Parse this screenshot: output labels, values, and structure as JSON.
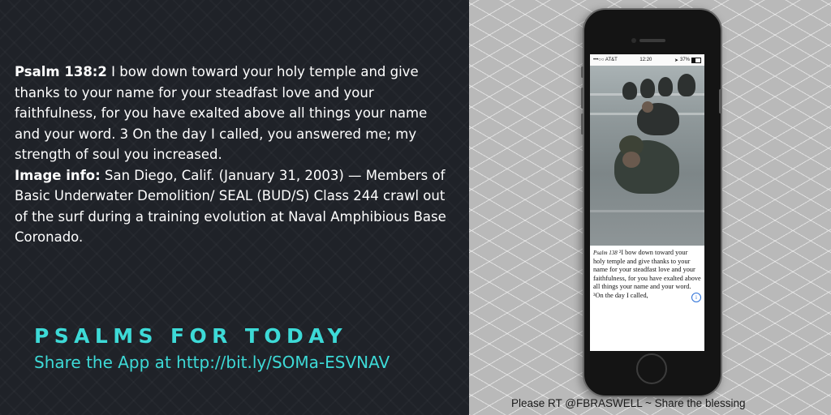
{
  "verse": {
    "reference": "Psalm 138:2",
    "text": "I bow down toward your holy temple and give thanks to your name for your steadfast love and your faithfulness, for you have exalted above all things your name and your word. 3 On the day I called, you answered me; my strength of soul you increased.",
    "image_info_label": "Image info:",
    "image_info_text": "San Diego, Calif. (January 31, 2003) — Members of Basic Underwater Demolition/ SEAL (BUD/S) Class 244 crawl out of the surf during a training evolution at Naval Amphibious Base Coronado."
  },
  "brand": {
    "title": "PSALMS FOR TODAY",
    "share_text": "Share the App at  http://bit.ly/SOMa-ESVNAV"
  },
  "footer": {
    "text": "Please RT @FBRASWELL ~ Share the blessing"
  },
  "phone": {
    "status": {
      "carrier": "•••○○ AT&T",
      "time": "12:20",
      "battery": "37%"
    },
    "caption": {
      "ref": "Psalm 138",
      "text": "²I bow down toward your holy temple and give thanks to your name for your steadfast love and your faithfulness, for you have exalted above all things your name and your word. ³On the day I called,"
    }
  },
  "colors": {
    "accent": "#3ddad7",
    "left_bg": "#1f2228",
    "right_bg": "#b9b9b9"
  }
}
